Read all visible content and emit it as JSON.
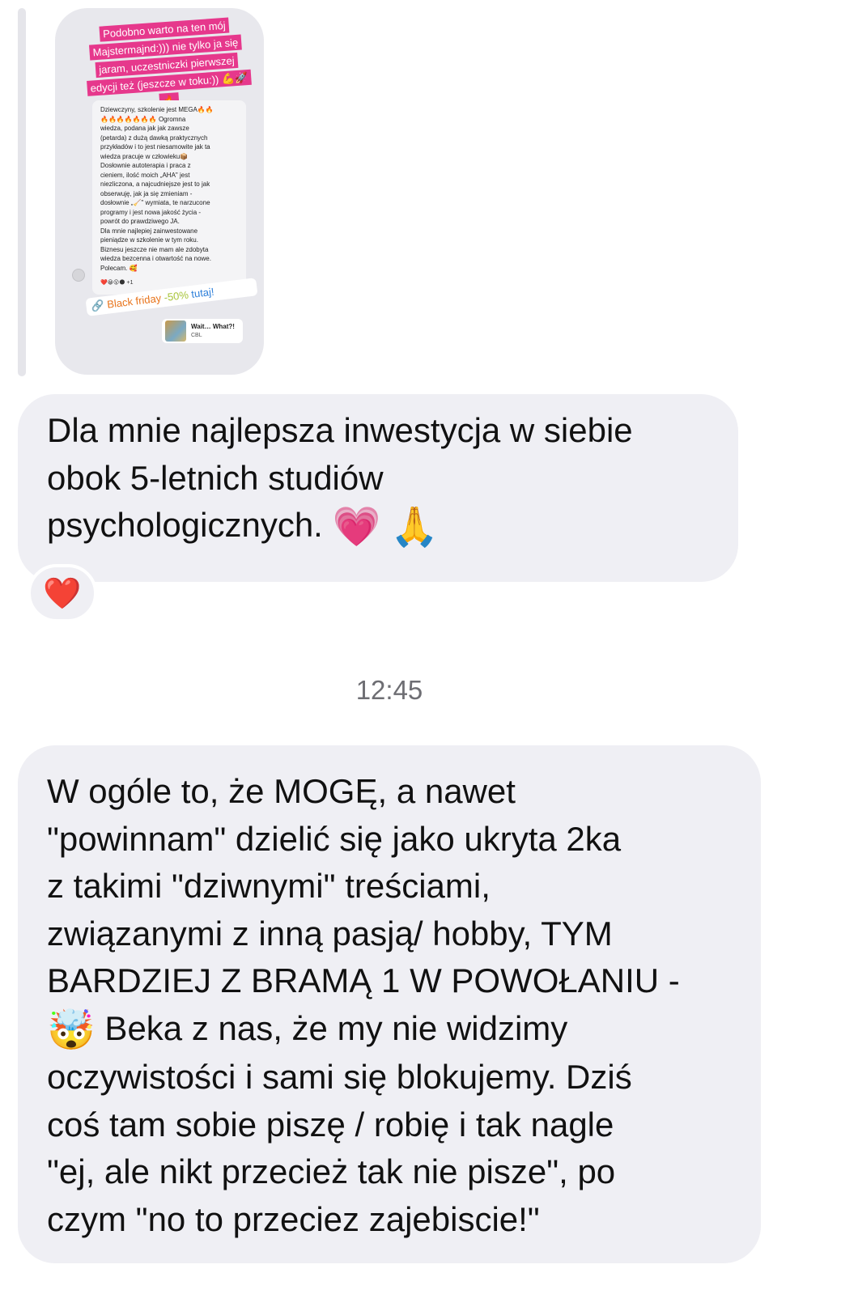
{
  "story": {
    "headline": "Podobno warto na ten mój Majstermajnd:))) nie tylko ja się jaram, uczestniczki pierwszej edycji też (jeszcze w toku:)) 💪🚀🔥",
    "comment": "Dziewczyny, szkolenie jest MEGA🔥🔥\n🔥🔥🔥🔥🔥🔥🔥 Ogromna\nwiedza, podana jak jak zawsze\n(petarda) z dużą dawką praktycznych\nprzykładów i to jest niesamowite jak ta\nwiedza pracuje w człowieku📦\nDosłownie autoterapia i praca z\ncieniem, ilość moich „AHA\" jest\nniezliczona, a najcudniejsze jest to jak\nobserwuję, jak ja się zmieniam -\ndosłownie „🧹\" wymiata, te narzucone\nprogramy i jest nowa jakość życia -\npowrót do prawdziwego JA.\nDla mnie najlepiej zainwestowane\npieniądze w szkolenie w tym roku.\nBiznesu jeszcze nie mam ale zdobyta\nwiedza bezcenna i otwartość na nowe.\nPolecam. 🥰",
    "comment_reactions": "❤️😀😮🌑 +1",
    "link_part1": "Black friday",
    "link_part2": "-50%",
    "link_part3": "tutaj!",
    "music_title": "Wait… What?!",
    "music_artist": "CBL"
  },
  "messages": [
    {
      "text": "Dla mnie najlepsza inwestycja w siebie\nobok 5-letnich studiów\npsychologicznych.",
      "emoji_1": "💗",
      "emoji_2": "🙏",
      "reaction": "❤️"
    },
    {
      "text_part1": "W ogóle to, że MOGĘ, a nawet\n\"powinnam\" dzielić się jako ukryta 2ka\nz takimi \"dziwnymi\" treściami,\nzwiązanymi z inną pasją/ hobby, TYM\nBARDZIEJ Z BRAMĄ 1 W POWOŁANIU -\n",
      "emoji": "🤯",
      "text_part2": " Beka z nas, że my nie widzimy\noczywistości i sami się blokujemy. Dziś\ncoś tam sobie piszę / robię i tak nagle\n\"ej, ale nikt przecież tak nie pisze\", po\nczym \"no to przeciez zajebiscie!\""
    }
  ],
  "timestamp": "12:45",
  "colors": {
    "bubble": "#efeff4",
    "story_highlight": "#e6388c",
    "reaction_heart": "#e0242f",
    "timestamp": "#6e6e73"
  },
  "icons": {
    "link": "link-icon",
    "reaction": "heart-icon"
  }
}
